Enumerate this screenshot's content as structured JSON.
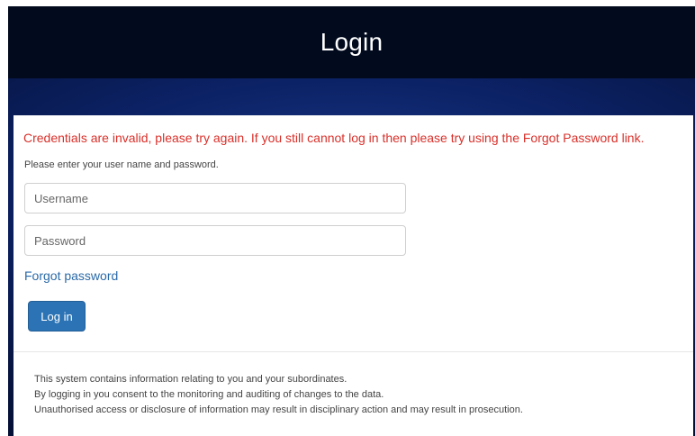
{
  "header": {
    "title": "Login"
  },
  "form": {
    "error_message": "Credentials are invalid, please try again. If you still cannot log in then please try using the Forgot Password link.",
    "instructions": "Please enter your user name and password.",
    "username_placeholder": "Username",
    "username_value": "",
    "password_placeholder": "Password",
    "password_value": "",
    "forgot_password_label": "Forgot password",
    "login_button_label": "Log in"
  },
  "notice": {
    "lines": [
      "This system contains information relating to you and your subordinates.",
      "By logging in you consent to the monitoring and auditing of changes to the data.",
      "Unauthorised access or disclosure of information may result in disciplinary action and may result in prosecution."
    ]
  },
  "colors": {
    "header_bg": "#020a1e",
    "error_text": "#d9302a",
    "link": "#2a6aa8",
    "primary_button": "#2b73b5"
  }
}
